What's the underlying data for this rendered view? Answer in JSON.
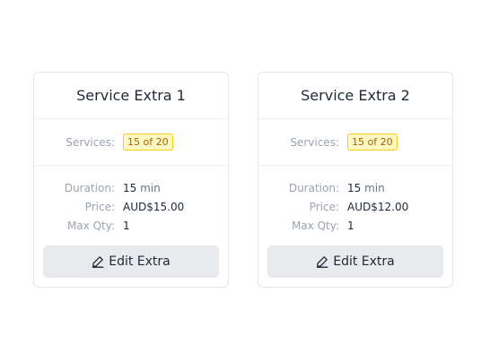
{
  "cards": [
    {
      "title": "Service Extra 1",
      "services_label": "Services:",
      "services_badge": "15 of 20",
      "duration_label": "Duration:",
      "duration_value": "15",
      "duration_unit": "min",
      "price_label": "Price:",
      "price_value": "AUD$15.00",
      "maxqty_label": "Max Qty:",
      "maxqty_value": "1",
      "edit_label": "Edit Extra"
    },
    {
      "title": "Service Extra 2",
      "services_label": "Services:",
      "services_badge": "15 of 20",
      "duration_label": "Duration:",
      "duration_value": "15",
      "duration_unit": "min",
      "price_label": "Price:",
      "price_value": "AUD$12.00",
      "maxqty_label": "Max Qty:",
      "maxqty_value": "1",
      "edit_label": "Edit Extra"
    }
  ],
  "colors": {
    "badge_bg": "#fef9c3",
    "badge_border": "#facc15",
    "badge_text": "#a16207",
    "button_bg": "#e9eaed"
  },
  "icons": {
    "edit": "pencil-icon"
  }
}
